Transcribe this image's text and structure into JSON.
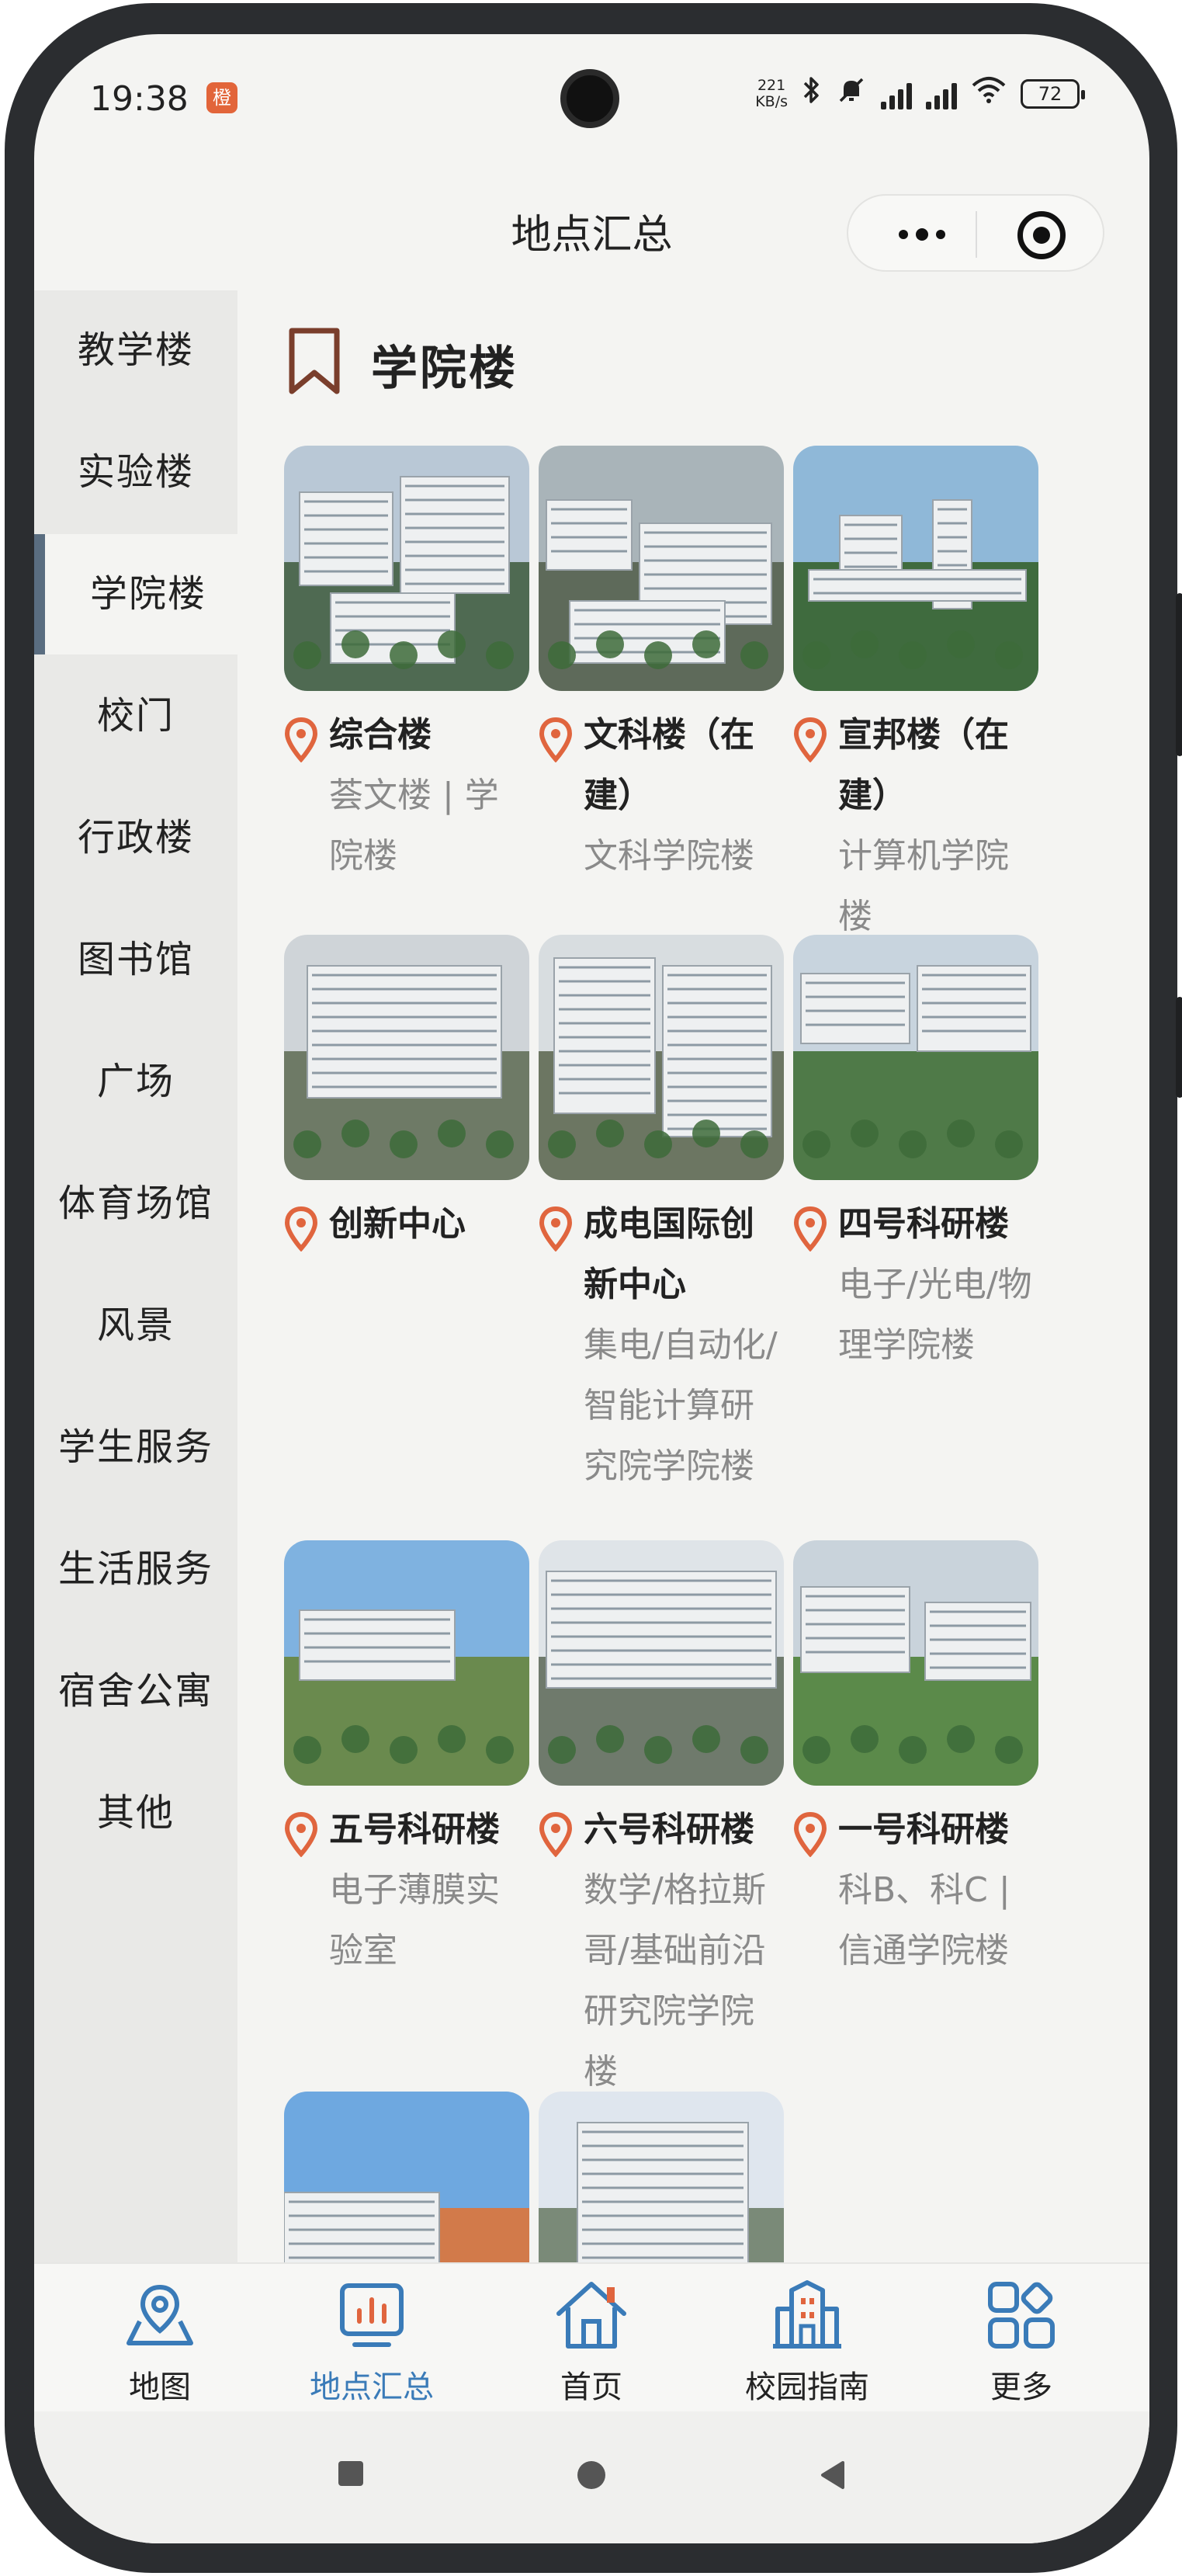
{
  "status_bar": {
    "time": "19:38",
    "app_badge": "橙",
    "net_speed_value": "221",
    "net_speed_unit": "KB/s",
    "battery": "72"
  },
  "header": {
    "title": "地点汇总"
  },
  "sidebar": {
    "items": [
      {
        "label": "教学楼",
        "active": false
      },
      {
        "label": "实验楼",
        "active": false
      },
      {
        "label": "学院楼",
        "active": true
      },
      {
        "label": "校门",
        "active": false
      },
      {
        "label": "行政楼",
        "active": false
      },
      {
        "label": "图书馆",
        "active": false
      },
      {
        "label": "广场",
        "active": false
      },
      {
        "label": "体育场馆",
        "active": false
      },
      {
        "label": "风景",
        "active": false
      },
      {
        "label": "学生服务",
        "active": false
      },
      {
        "label": "生活服务",
        "active": false
      },
      {
        "label": "宿舍公寓",
        "active": false
      },
      {
        "label": "其他",
        "active": false
      }
    ]
  },
  "section": {
    "title": "学院楼"
  },
  "cards": [
    {
      "name": "综合楼",
      "desc": "荟文楼 | 学院楼"
    },
    {
      "name": "文科楼（在建）",
      "desc": "文科学院楼"
    },
    {
      "name": "宣邦楼（在建）",
      "desc": "计算机学院楼"
    },
    {
      "name": "创新中心",
      "desc": ""
    },
    {
      "name": "成电国际创新中心",
      "desc": "集电/自动化/智能计算研究院学院楼"
    },
    {
      "name": "四号科研楼",
      "desc": "电子/光电/物理学院楼"
    },
    {
      "name": "五号科研楼",
      "desc": "电子薄膜实验室"
    },
    {
      "name": "六号科研楼",
      "desc": "数学/格拉斯哥/基础前沿研究院学院楼"
    },
    {
      "name": "一号科研楼",
      "desc": "科B、科C | 信通学院楼"
    }
  ],
  "tabbar": {
    "items": [
      {
        "label": "地图",
        "icon": "map-pin-icon",
        "active": false
      },
      {
        "label": "地点汇总",
        "icon": "chart-board-icon",
        "active": true
      },
      {
        "label": "首页",
        "icon": "home-icon",
        "active": false
      },
      {
        "label": "校园指南",
        "icon": "building-icon",
        "active": false
      },
      {
        "label": "更多",
        "icon": "grid-more-icon",
        "active": false
      }
    ]
  },
  "colors": {
    "accent": "#3a7bb8",
    "pin": "#e0653e",
    "sidebar_bg": "#e9e9e7",
    "sidebar_active_mark": "#5a6d80",
    "bookmark": "#7a3e2c"
  }
}
